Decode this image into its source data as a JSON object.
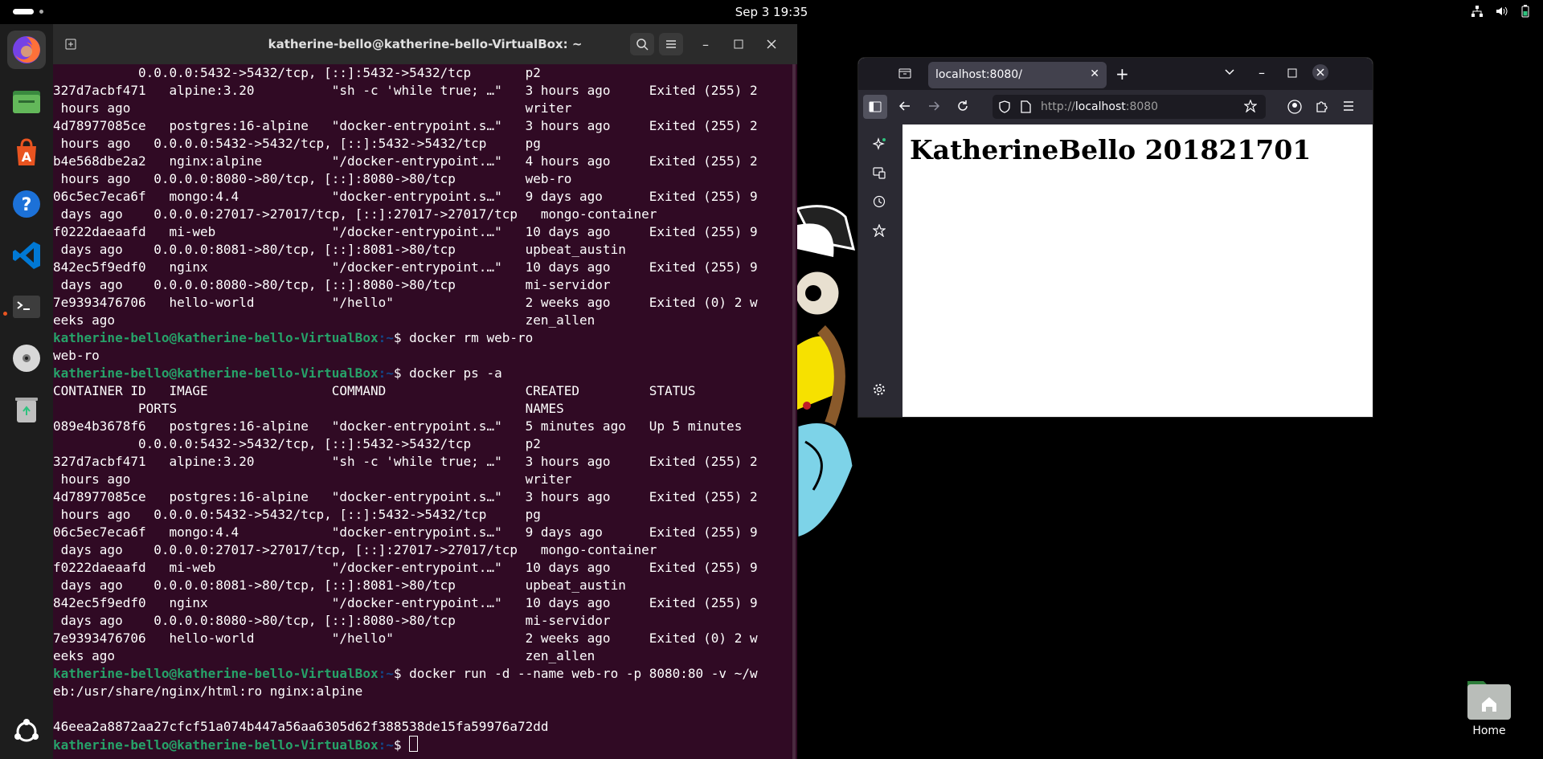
{
  "topbar": {
    "clock": "Sep 3  19:35"
  },
  "dock": {
    "items": [
      {
        "name": "firefox"
      },
      {
        "name": "files"
      },
      {
        "name": "app-center"
      },
      {
        "name": "help"
      },
      {
        "name": "vscode"
      },
      {
        "name": "terminal"
      },
      {
        "name": "disc"
      },
      {
        "name": "trash"
      }
    ]
  },
  "terminal": {
    "title": "katherine-bello@katherine-bello-VirtualBox: ~",
    "prompt_user": "katherine-bello@katherine-bello-VirtualBox",
    "prompt_path": ":~",
    "lines": [
      "           0.0.0.0:5432->5432/tcp, [::]:5432->5432/tcp       p2",
      "327d7acbf471   alpine:3.20          \"sh -c 'while true; …\"   3 hours ago     Exited (255) 2",
      " hours ago                                                   writer",
      "4d78977085ce   postgres:16-alpine   \"docker-entrypoint.s…\"   3 hours ago     Exited (255) 2",
      " hours ago   0.0.0.0:5432->5432/tcp, [::]:5432->5432/tcp     pg",
      "b4e568dbe2a2   nginx:alpine         \"/docker-entrypoint.…\"   4 hours ago     Exited (255) 2",
      " hours ago   0.0.0.0:8080->80/tcp, [::]:8080->80/tcp         web-ro",
      "06c5ec7eca6f   mongo:4.4            \"docker-entrypoint.s…\"   9 days ago      Exited (255) 9",
      " days ago    0.0.0.0:27017->27017/tcp, [::]:27017->27017/tcp   mongo-container",
      "f0222daeaafd   mi-web               \"/docker-entrypoint.…\"   10 days ago     Exited (255) 9",
      " days ago    0.0.0.0:8081->80/tcp, [::]:8081->80/tcp         upbeat_austin",
      "842ec5f9edf0   nginx                \"/docker-entrypoint.…\"   10 days ago     Exited (255) 9",
      " days ago    0.0.0.0:8080->80/tcp, [::]:8080->80/tcp         mi-servidor",
      "7e9393476706   hello-world          \"/hello\"                 2 weeks ago     Exited (0) 2 w",
      "eeks ago                                                     zen_allen",
      "@@$ docker rm web-ro",
      "web-ro",
      "@@$ docker ps -a",
      "CONTAINER ID   IMAGE                COMMAND                  CREATED         STATUS",
      "           PORTS                                             NAMES",
      "089e4b3678f6   postgres:16-alpine   \"docker-entrypoint.s…\"   5 minutes ago   Up 5 minutes",
      "           0.0.0.0:5432->5432/tcp, [::]:5432->5432/tcp       p2",
      "327d7acbf471   alpine:3.20          \"sh -c 'while true; …\"   3 hours ago     Exited (255) 2",
      " hours ago                                                   writer",
      "4d78977085ce   postgres:16-alpine   \"docker-entrypoint.s…\"   3 hours ago     Exited (255) 2",
      " hours ago   0.0.0.0:5432->5432/tcp, [::]:5432->5432/tcp     pg",
      "06c5ec7eca6f   mongo:4.4            \"docker-entrypoint.s…\"   9 days ago      Exited (255) 9",
      " days ago    0.0.0.0:27017->27017/tcp, [::]:27017->27017/tcp   mongo-container",
      "f0222daeaafd   mi-web               \"/docker-entrypoint.…\"   10 days ago     Exited (255) 9",
      " days ago    0.0.0.0:8081->80/tcp, [::]:8081->80/tcp         upbeat_austin",
      "842ec5f9edf0   nginx                \"/docker-entrypoint.…\"   10 days ago     Exited (255) 9",
      " days ago    0.0.0.0:8080->80/tcp, [::]:8080->80/tcp         mi-servidor",
      "7e9393476706   hello-world          \"/hello\"                 2 weeks ago     Exited (0) 2 w",
      "eeks ago                                                     zen_allen",
      "@@$ docker run -d --name web-ro -p 8080:80 -v ~/w",
      "eb:/usr/share/nginx/html:ro nginx:alpine",
      "",
      "46eea2a8872aa27cfcf51a074b447a56aa6305d62f388538de15fa59976a72dd",
      "@@$ "
    ]
  },
  "browser": {
    "tab_title": "localhost:8080/",
    "url_prefix": "http://",
    "url_host": "localhost",
    "url_suffix": ":8080",
    "page_heading": "KatherineBello 201821701"
  },
  "desktop": {
    "home_label": "Home"
  }
}
